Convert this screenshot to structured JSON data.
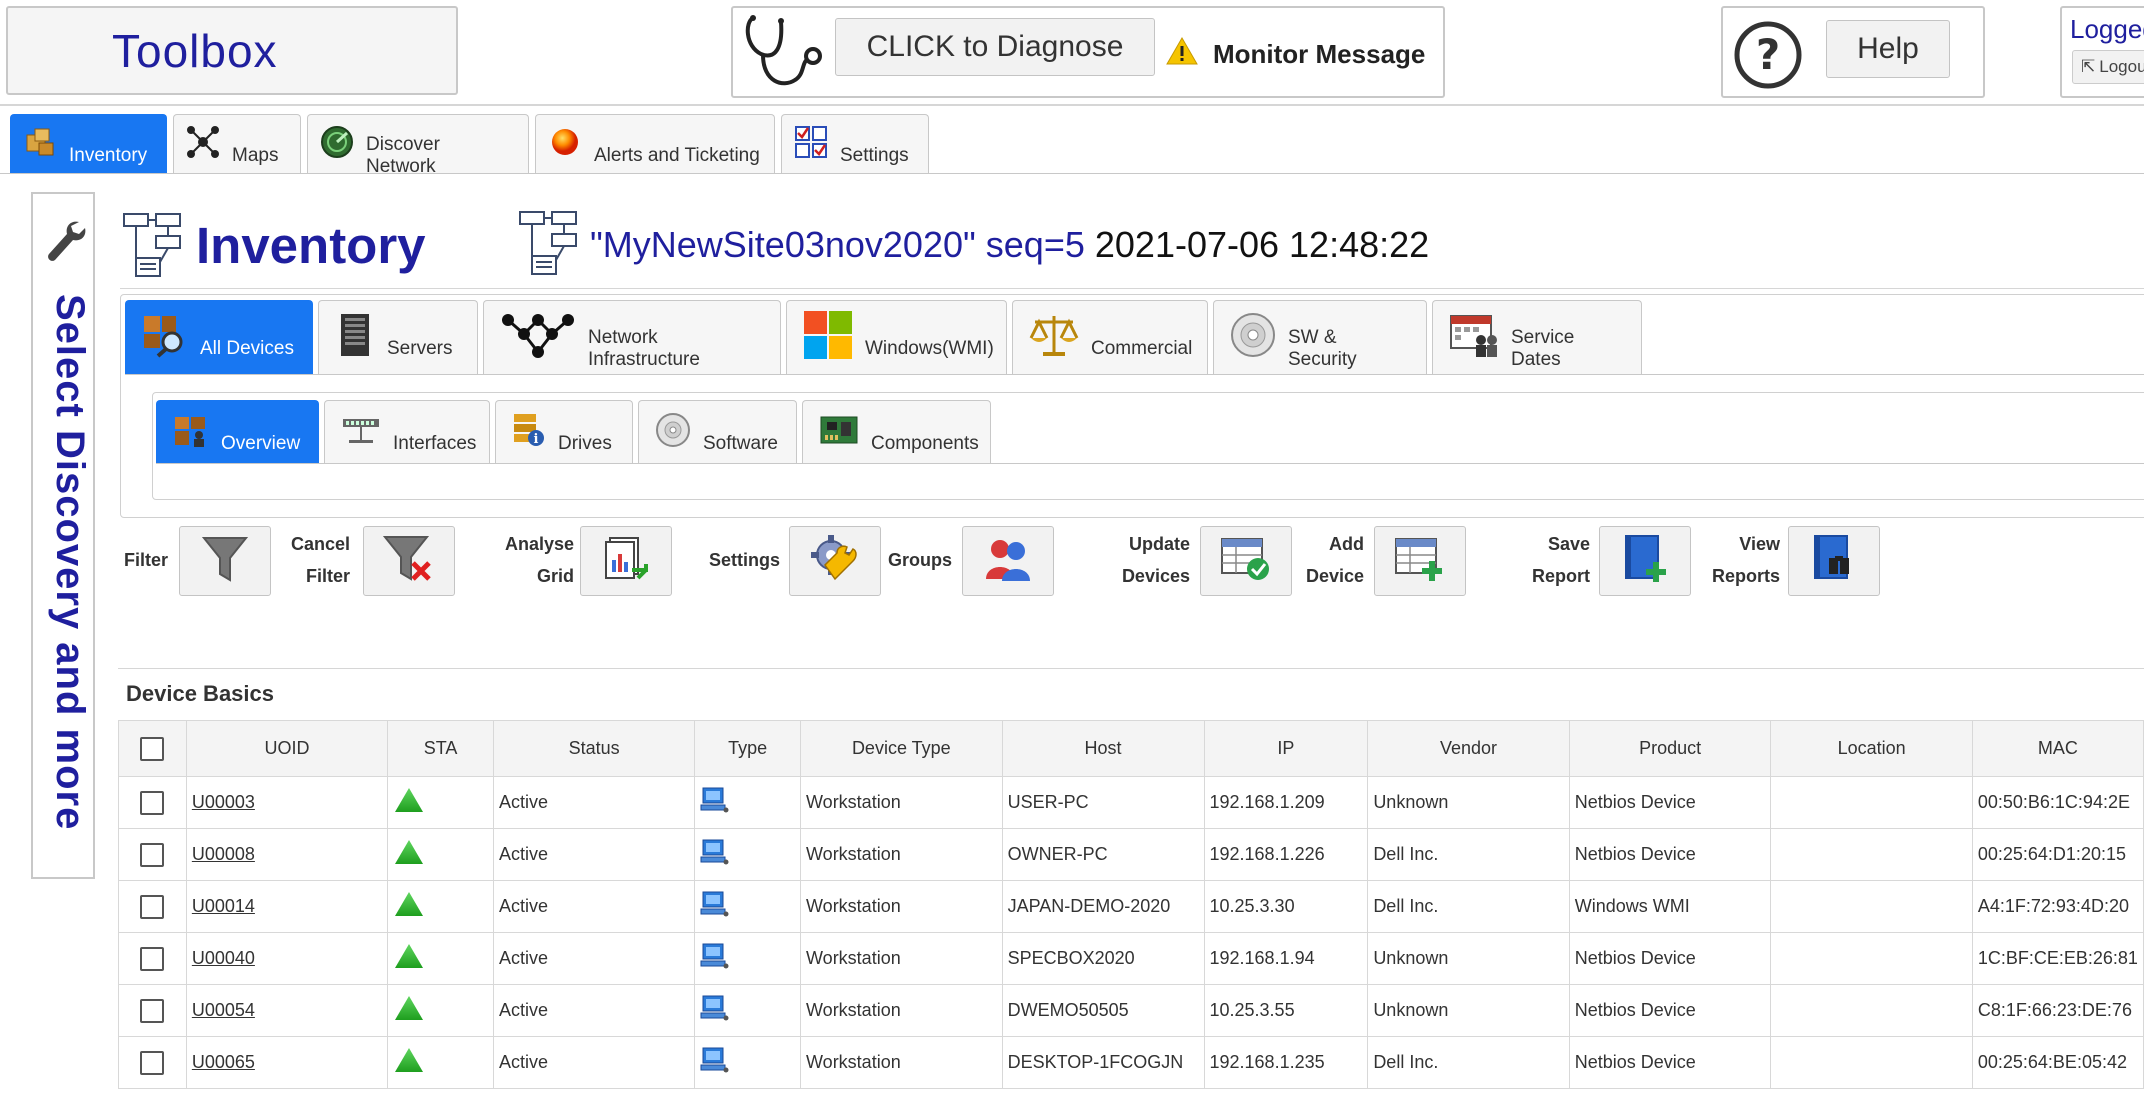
{
  "header": {
    "toolbox_title": "Toolbox",
    "diagnose_label": "CLICK to Diagnose",
    "monitor_label": "Monitor Message",
    "help_label": "Help",
    "logged_in_label": "Logged",
    "logout_label": "Logou"
  },
  "main_tabs": [
    {
      "label": "Inventory",
      "icon": "inventory-box-icon",
      "active": true
    },
    {
      "label": "Maps",
      "icon": "network-map-icon"
    },
    {
      "label": "Discover Network",
      "icon": "radar-icon"
    },
    {
      "label": "Alerts and Ticketing",
      "icon": "alert-ball-icon"
    },
    {
      "label": "Settings",
      "icon": "checklist-icon"
    }
  ],
  "sidebar": {
    "label": "Select Discovery and more"
  },
  "page": {
    "title": "Inventory",
    "site_name": "\"MyNewSite03nov2020\" seq=5",
    "timestamp": "2021-07-06 12:48:22"
  },
  "category_tabs": [
    {
      "label": "All Devices",
      "active": true
    },
    {
      "label": "Servers"
    },
    {
      "label": "Network Infrastructure"
    },
    {
      "label": "Windows(WMI)"
    },
    {
      "label": "Commercial"
    },
    {
      "label": "SW & Security"
    },
    {
      "label": "Service Dates"
    }
  ],
  "view_tabs": [
    {
      "label": "Overview",
      "active": true
    },
    {
      "label": "Interfaces"
    },
    {
      "label": "Drives"
    },
    {
      "label": "Software"
    },
    {
      "label": "Components"
    }
  ],
  "toolbar": {
    "filter": "Filter",
    "cancel_filter_1": "Cancel",
    "cancel_filter_2": "Filter",
    "analyse_grid_1": "Analyse",
    "analyse_grid_2": "Grid",
    "settings": "Settings",
    "groups": "Groups",
    "update_devices_1": "Update",
    "update_devices_2": "Devices",
    "add_device_1": "Add",
    "add_device_2": "Device",
    "save_report_1": "Save",
    "save_report_2": "Report",
    "view_reports_1": "View",
    "view_reports_2": "Reports"
  },
  "grid": {
    "title": "Device Basics",
    "columns": [
      "UOID",
      "STA",
      "Status",
      "Type",
      "Device Type",
      "Host",
      "IP",
      "Vendor",
      "Product",
      "Location",
      "MAC"
    ],
    "rows": [
      {
        "uoid": "U00003",
        "status": "Active",
        "device_type": "Workstation",
        "host": "USER-PC",
        "ip": "192.168.1.209",
        "vendor": "Unknown",
        "product": "Netbios Device",
        "location": "",
        "mac": "00:50:B6:1C:94:2E"
      },
      {
        "uoid": "U00008",
        "status": "Active",
        "device_type": "Workstation",
        "host": "OWNER-PC",
        "ip": "192.168.1.226",
        "vendor": "Dell Inc.",
        "product": "Netbios Device",
        "location": "",
        "mac": "00:25:64:D1:20:15"
      },
      {
        "uoid": "U00014",
        "status": "Active",
        "device_type": "Workstation",
        "host": "JAPAN-DEMO-2020",
        "ip": "10.25.3.30",
        "vendor": "Dell Inc.",
        "product": "Windows WMI",
        "location": "",
        "mac": "A4:1F:72:93:4D:20"
      },
      {
        "uoid": "U00040",
        "status": "Active",
        "device_type": "Workstation",
        "host": "SPECBOX2020",
        "ip": "192.168.1.94",
        "vendor": "Unknown",
        "product": "Netbios Device",
        "location": "",
        "mac": "1C:BF:CE:EB:26:81"
      },
      {
        "uoid": "U00054",
        "status": "Active",
        "device_type": "Workstation",
        "host": "DWEMO50505",
        "ip": "10.25.3.55",
        "vendor": "Unknown",
        "product": "Netbios Device",
        "location": "",
        "mac": "C8:1F:66:23:DE:76"
      },
      {
        "uoid": "U00065",
        "status": "Active",
        "device_type": "Workstation",
        "host": "DESKTOP-1FCOGJN",
        "ip": "192.168.1.235",
        "vendor": "Dell Inc.",
        "product": "Netbios Device",
        "location": "",
        "mac": "00:25:64:BE:05:42"
      }
    ]
  },
  "colors": {
    "accent_blue": "#1877f2",
    "title_navy": "#1f1f9e",
    "status_green": "#2db52d"
  }
}
